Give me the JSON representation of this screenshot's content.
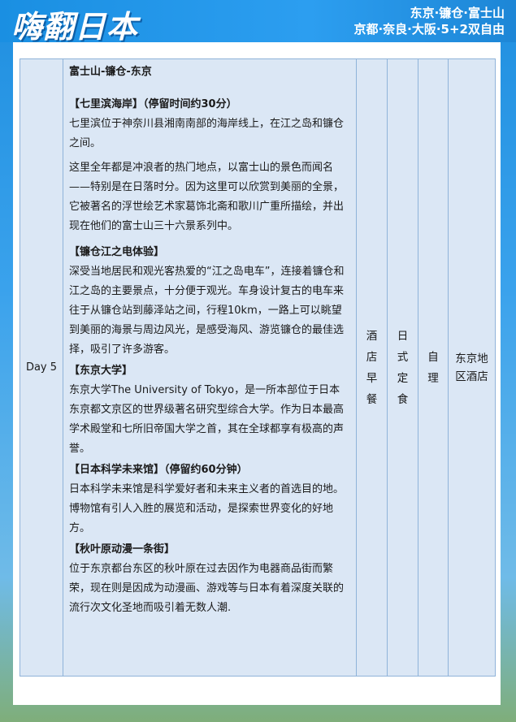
{
  "header": {
    "brand": "嗨翻日本",
    "route_line1": "东京·镰仓·富士山",
    "route_line2": "京都·奈良·大阪·5+2双自由"
  },
  "itinerary": {
    "day": "Day 5",
    "route_title": "富士山-镰仓-东京",
    "sections": [
      {
        "heading": "【七里滨海岸】（停留时间约30分）",
        "paragraphs": [
          "七里滨位于神奈川县湘南南部的海岸线上，在江之岛和镰仓之间。",
          "这里全年都是冲浪者的热门地点，以富士山的景色而闻名——特别是在日落时分。因为这里可以欣赏到美丽的全景，它被著名的浮世绘艺术家葛饰北斋和歌川广重所描绘，并出现在他们的富士山三十六景系列中。"
        ]
      },
      {
        "heading": "【镰仓江之电体验】",
        "paragraphs": [
          "深受当地居民和观光客热爱的“江之岛电车”，连接着镰仓和江之岛的主要景点，十分便于观光。车身设计复古的电车来往于从镰仓站到藤泽站之间，行程10km，一路上可以眺望到美丽的海景与周边风光，是感受海风、游览镰仓的最佳选择，吸引了许多游客。"
        ]
      },
      {
        "heading": "【东京大学】",
        "paragraphs": [
          "东京大学The University of Tokyo，是一所本部位于日本东京都文京区的世界级著名研究型综合大学。作为日本最高学术殿堂和七所旧帝国大学之首，其在全球都享有极高的声誉。"
        ]
      },
      {
        "heading": "【日本科学未来馆】（停留约60分钟）",
        "paragraphs": [
          "日本科学未来馆是科学爱好者和未来主义者的首选目的地。博物馆有引人入胜的展览和活动，是探索世界变化的好地方。"
        ]
      },
      {
        "heading": "【秋叶原动漫一条街】",
        "paragraphs": [
          "位于东京都台东区的秋叶原在过去因作为电器商品街而繁荣，现在则是因成为动漫画、游戏等与日本有着深度关联的流行次文化圣地而吸引着无数人潮."
        ]
      }
    ],
    "breakfast": "酒店早餐",
    "lunch": "日式定食",
    "dinner": "自理",
    "hotel": "东京地区酒店"
  },
  "colors": {
    "header_blue": "#1f8fe0",
    "cell_fill": "#dbe7f5",
    "cell_border": "#8fb3d9"
  }
}
